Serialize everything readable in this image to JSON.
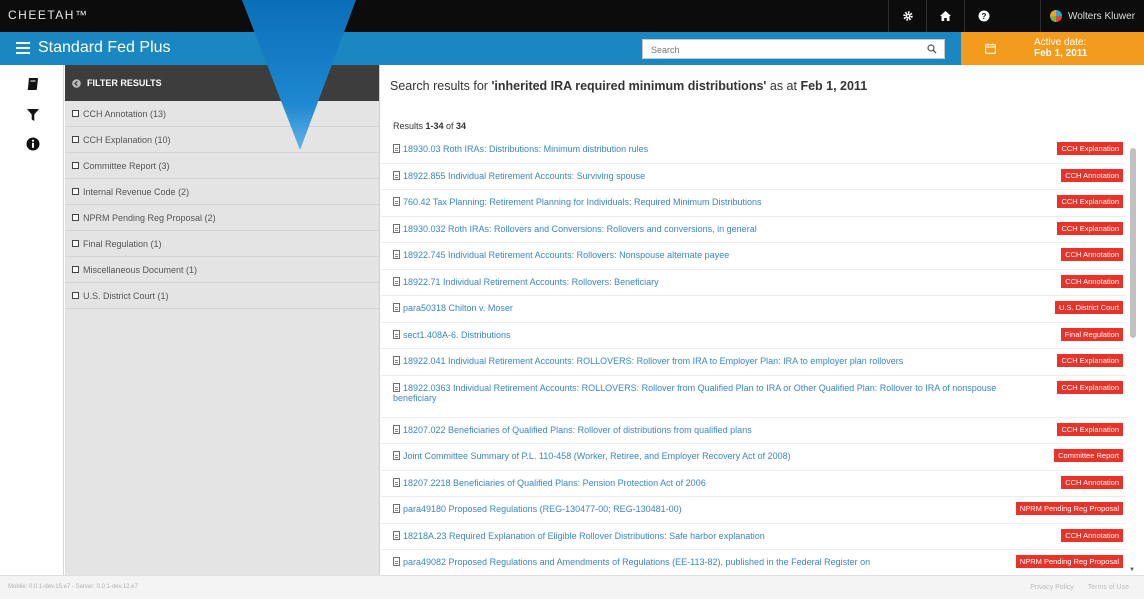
{
  "topbar": {
    "brand": "CHEETAH™",
    "icons": [
      "gear-icon",
      "home-icon",
      "help-icon"
    ],
    "account_label": "Wolters Kluwer"
  },
  "appbar": {
    "title": "Standard Fed Plus",
    "search_placeholder": "Search",
    "active_date_label": "Active date:",
    "active_date_value": "Feb 1, 2011"
  },
  "rail": {
    "icons": [
      "book-icon",
      "filter-icon",
      "info-icon"
    ]
  },
  "filter": {
    "heading": "FILTER RESULTS",
    "items": [
      "CCH Annotation (13)",
      "CCH Explanation (10)",
      "Committee Report (3)",
      "Internal Revenue Code (2)",
      "NPRM Pending Reg Proposal (2)",
      "Final Regulation (1)",
      "Miscellaneous Document (1)",
      "U.S. District Court (1)"
    ]
  },
  "results": {
    "header_prefix": "Search results for ",
    "query": "'inherited IRA required minimum distributions'",
    "header_mid": " as at ",
    "date": "Feb 1, 2011",
    "count_prefix": "Results ",
    "count_range": "1-34",
    "count_mid": " of ",
    "count_total": "34",
    "items": [
      {
        "title": "18930.03 Roth IRAs: Distributions: Minimum distribution rules",
        "badge": "CCH Explanation"
      },
      {
        "title": "18922.855 Individual Retirement Accounts: Surviving spouse",
        "badge": "CCH Annotation"
      },
      {
        "title": "760.42 Tax Planning: Retirement Planning for Individuals: Required Minimum Distributions",
        "badge": "CCH Explanation"
      },
      {
        "title": "18930.032 Roth IRAs: Rollovers and Conversions: Rollovers and conversions, in general",
        "badge": "CCH Explanation"
      },
      {
        "title": "18922.745 Individual Retirement Accounts: Rollovers: Nonspouse alternate payee",
        "badge": "CCH Annotation"
      },
      {
        "title": "18922.71 Individual Retirement Accounts: Rollovers: Beneficiary",
        "badge": "CCH Annotation"
      },
      {
        "title": "para50318 Chilton v. Moser",
        "badge": "U.S. District Court"
      },
      {
        "title": "sect1.408A-6. Distributions",
        "badge": "Final Regulation"
      },
      {
        "title": "18922.041 Individual Retirement Accounts: ROLLOVERS: Rollover from IRA to Employer Plan: IRA to employer plan rollovers",
        "badge": "CCH Explanation"
      },
      {
        "title": "18922.0363 Individual Retirement Accounts: ROLLOVERS: Rollover from Qualified Plan to IRA or Other Qualified Plan: Rollover to IRA of nonspouse beneficiary",
        "badge": "CCH Explanation"
      },
      {
        "title": "18207.022 Beneficiaries of Qualified Plans: Rollover of distributions from qualified plans",
        "badge": "CCH Explanation"
      },
      {
        "title": "Joint Committee Summary of P.L. 110-458 (Worker, Retiree, and Employer Recovery Act of 2008)",
        "badge": "Committee Report"
      },
      {
        "title": "18207.2218 Beneficiaries of Qualified Plans: Pension Protection Act of 2006",
        "badge": "CCH Annotation"
      },
      {
        "title": "para49180 Proposed Regulations (REG-130477-00; REG-130481-00)",
        "badge": "NPRM Pending Reg Proposal"
      },
      {
        "title": "18218A.23 Required Explanation of Eligible Rollover Distributions: Safe harbor explanation",
        "badge": "CCH Annotation"
      },
      {
        "title": "para49082 Proposed Regulations and Amendments of Regulations (EE-113-82), published in the Federal Register on",
        "badge": "NPRM Pending Reg Proposal"
      }
    ]
  },
  "footer": {
    "version": "Mobile: 0.0.1-dev.15.e7 - Server: 0.0.1-dev.12.e7",
    "privacy": "Privacy Policy",
    "terms": "Terms of Use"
  },
  "colors": {
    "appbar": "#1a87c1",
    "accent_orange": "#f39b1c",
    "badge_red": "#e8332a",
    "link_blue": "#3a86c4"
  }
}
